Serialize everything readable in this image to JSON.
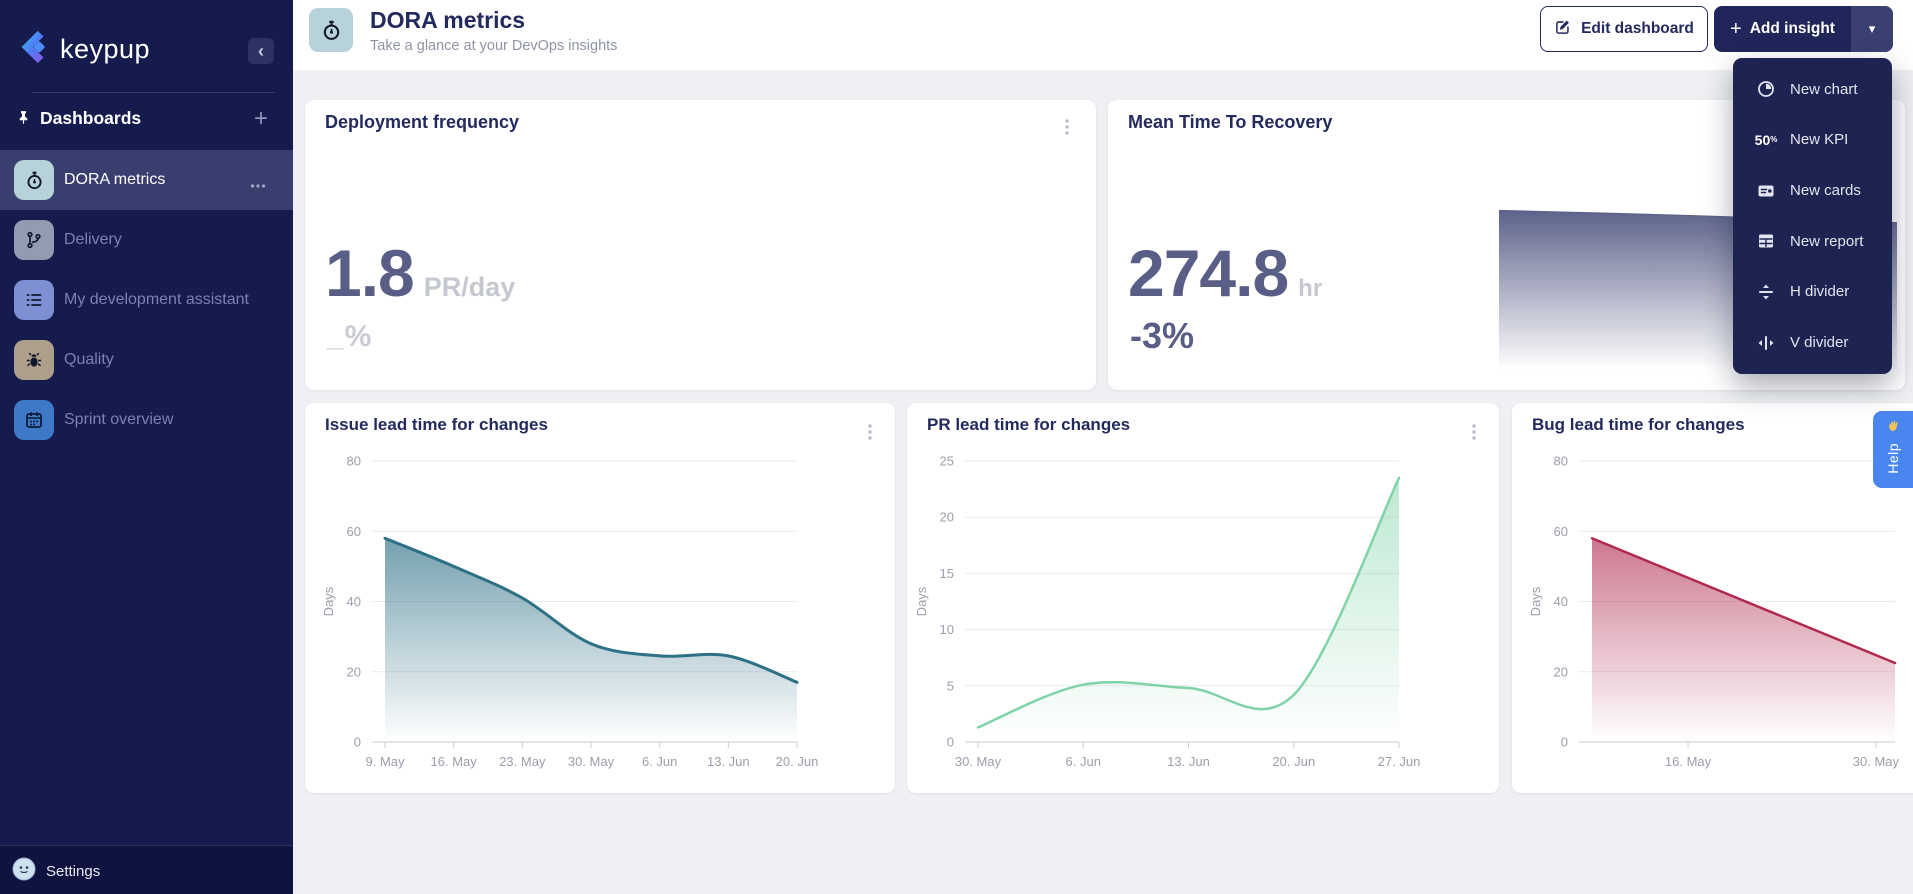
{
  "sidebar": {
    "logo_text": "keypup",
    "section_title": "Dashboards",
    "items": [
      {
        "label": "DORA metrics",
        "icon": "stopwatch-icon",
        "tile_color": "#b7d2d9",
        "active": true
      },
      {
        "label": "Delivery",
        "icon": "git-branch-icon",
        "tile_color": "#919cb3",
        "active": false
      },
      {
        "label": "My development assistant",
        "icon": "checklist-icon",
        "tile_color": "#7e8fd3",
        "active": false
      },
      {
        "label": "Quality",
        "icon": "bug-icon",
        "tile_color": "#ad9f89",
        "active": false
      },
      {
        "label": "Sprint overview",
        "icon": "calendar-icon",
        "tile_color": "#3d79c6",
        "active": false
      }
    ],
    "settings_label": "Settings"
  },
  "header": {
    "title": "DORA metrics",
    "subtitle": "Take a glance at your DevOps insights",
    "edit_button_label": "Edit dashboard",
    "add_button_label": "Add insight"
  },
  "menu": {
    "items": [
      {
        "label": "New chart",
        "icon": "donut-chart-icon"
      },
      {
        "label": "New KPI",
        "icon": "kpi-50-icon",
        "icon_text": "50"
      },
      {
        "label": "New cards",
        "icon": "cards-icon"
      },
      {
        "label": "New report",
        "icon": "report-icon"
      },
      {
        "label": "H divider",
        "icon": "h-divider-icon"
      },
      {
        "label": "V divider",
        "icon": "v-divider-icon"
      }
    ]
  },
  "kpis": [
    {
      "title": "Deployment frequency",
      "value": "1.8",
      "unit": "PR/day",
      "delta": "_%"
    },
    {
      "title": "Mean Time To Recovery",
      "value": "274.8",
      "unit": "hr",
      "delta": "-3%"
    }
  ],
  "help": {
    "label": "Help"
  },
  "colors": {
    "sidebar_bg": "#151b4d",
    "primary_navy": "#232a5e",
    "kpi_value": "#585e86",
    "muted_unit": "#c5c7d1",
    "issue_line": "#2e7086",
    "pr_line": "#7fd3a6",
    "bug_line": "#b02a50",
    "sparkline_fill": "#5a6089",
    "help_blue": "#4a86ef"
  },
  "chart_data": [
    {
      "id": "issue-lead-time",
      "type": "area",
      "title": "Issue lead time for changes",
      "xlabel": "",
      "ylabel": "Days",
      "y_max": 80,
      "y_ticks": [
        0,
        20,
        40,
        60,
        80
      ],
      "x": [
        "9. May",
        "16. May",
        "23. May",
        "30. May",
        "6. Jun",
        "13. Jun",
        "20. Jun"
      ],
      "values": [
        58,
        50,
        41,
        28,
        24.5,
        24.5,
        17
      ],
      "line_color": "#2e7086",
      "line_width": 3,
      "fill_opacity": 0.92,
      "grid": true,
      "legend": false
    },
    {
      "id": "pr-lead-time",
      "type": "area",
      "title": "PR lead time for changes",
      "xlabel": "",
      "ylabel": "Days",
      "y_max": 25,
      "y_ticks": [
        0,
        5,
        10,
        15,
        20,
        25
      ],
      "x": [
        "30. May",
        "6. Jun",
        "13. Jun",
        "20. Jun",
        "27. Jun"
      ],
      "values": [
        1.3,
        5.1,
        4.8,
        4.2,
        23.5
      ],
      "line_color": "#7fd3a6",
      "line_width": 2.5,
      "fill_opacity": 0.55,
      "grid": true,
      "legend": false
    },
    {
      "id": "bug-lead-time",
      "type": "area",
      "title": "Bug lead time for changes",
      "xlabel": "",
      "ylabel": "Days",
      "y_max": 80,
      "y_ticks": [
        0,
        20,
        40,
        60,
        80
      ],
      "x": [
        "16. May",
        "30. May"
      ],
      "x_tick_fracs": [
        0.317,
        0.937
      ],
      "values": [
        58,
        22.5
      ],
      "point_fracs": [
        0,
        1
      ],
      "line_color": "#b02a50",
      "line_width": 2.5,
      "fill_opacity": 0.88,
      "grid": true,
      "legend": false
    },
    {
      "id": "mttr-sparkline",
      "type": "area",
      "title": "",
      "y_max": 100,
      "values": [
        98.5,
        97,
        95.2,
        93.2,
        91
      ],
      "point_fracs": [
        0,
        0.25,
        0.5,
        0.75,
        1
      ],
      "line_color": "#5a6089",
      "line_width": 1,
      "fill_opacity": 1,
      "grid": false,
      "legend": false
    }
  ]
}
